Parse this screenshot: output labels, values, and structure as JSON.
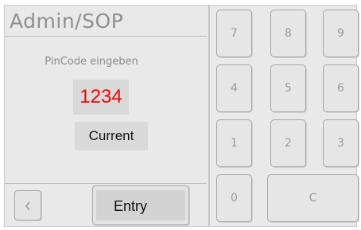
{
  "header": {
    "title": "Admin/SOP"
  },
  "pin": {
    "prompt": "PinCode eingeben",
    "value": "1234",
    "value_color": "#ff0000",
    "mode": "Current"
  },
  "footer": {
    "back_icon": "chevron-left-icon",
    "entry_label": "Entry"
  },
  "keypad": {
    "keys": [
      "7",
      "8",
      "9",
      "4",
      "5",
      "6",
      "1",
      "2",
      "3",
      "0",
      "C"
    ]
  }
}
